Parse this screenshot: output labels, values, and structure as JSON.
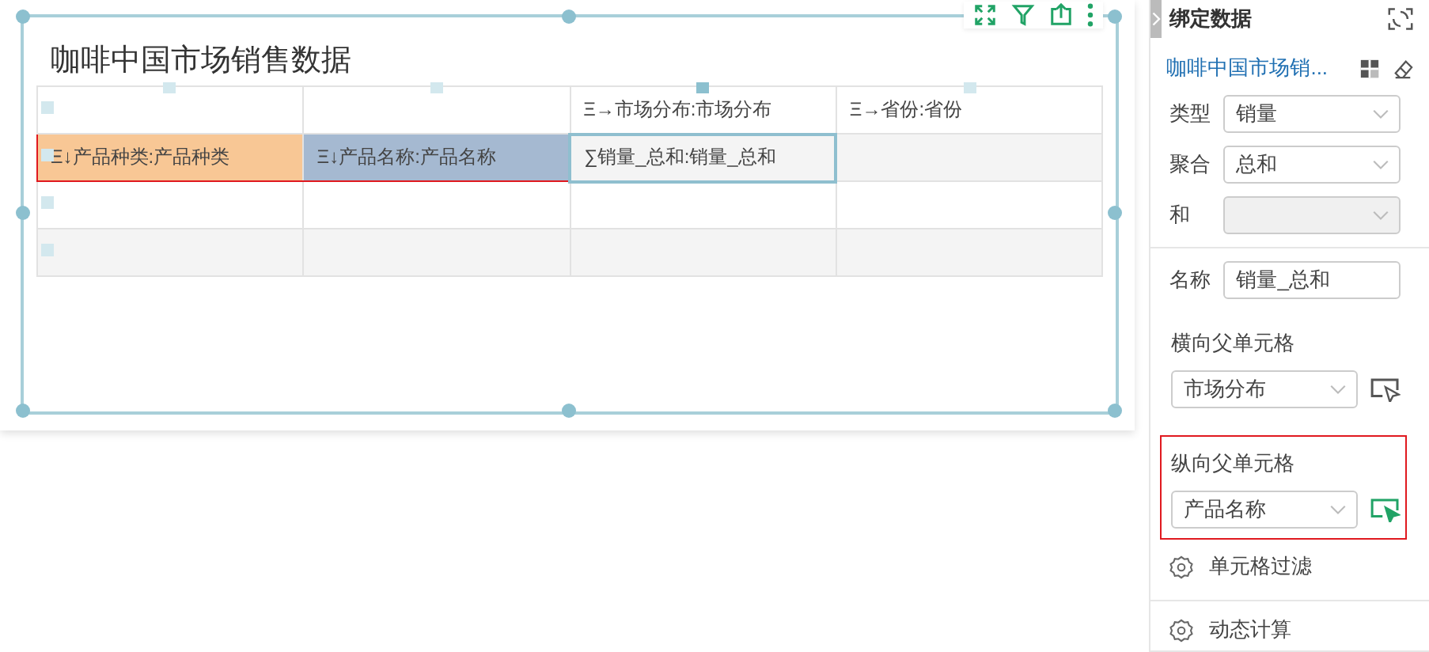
{
  "widget": {
    "title": "咖啡中国市场销售数据"
  },
  "table": {
    "rows": [
      [
        {},
        {},
        {
          "text": "Ξ→市场分布:市场分布"
        },
        {
          "text": "Ξ→省份:省份"
        }
      ],
      [
        {
          "text": "Ξ↓产品种类:产品种类",
          "color": "#f8c795",
          "marked": true
        },
        {
          "text": "Ξ↓产品名称:产品名称",
          "color": "#a5b9d1",
          "marked": true
        },
        {
          "text": "∑销量_总和:销量_总和",
          "selected": true
        },
        {}
      ],
      [
        {},
        {},
        {},
        {}
      ],
      [
        {},
        {},
        {},
        {}
      ]
    ]
  },
  "panel": {
    "title": "绑定数据",
    "dataset": "咖啡中国市场销...",
    "fields": [
      {
        "kind": "select",
        "label": "类型",
        "value": "销量",
        "disabled": false
      },
      {
        "kind": "select",
        "label": "聚合",
        "value": "总和",
        "disabled": false
      },
      {
        "kind": "select",
        "label": "和",
        "disabled": true
      },
      {
        "kind": "input",
        "label": "名称",
        "value": "销量_总和"
      }
    ],
    "parents": [
      {
        "label": "横向父单元格",
        "value": "市场分布",
        "active": false
      },
      {
        "label": "纵向父单元格",
        "value": "产品名称",
        "active": true
      }
    ],
    "actions": [
      {
        "label": "单元格过滤"
      },
      {
        "label": "动态计算"
      }
    ]
  }
}
